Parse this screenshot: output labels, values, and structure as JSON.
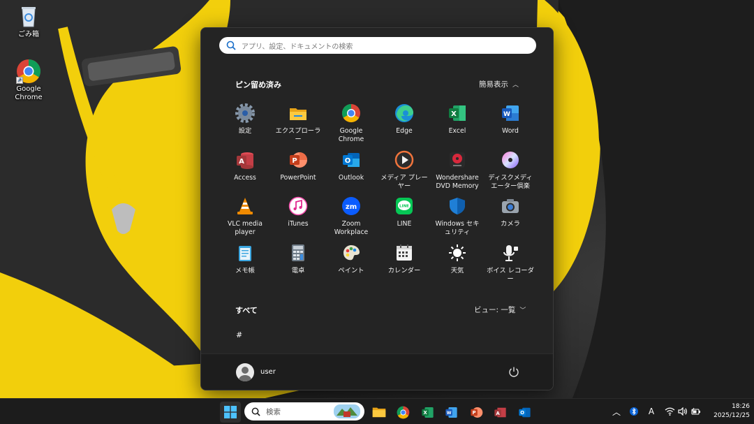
{
  "desktop": {
    "icons": [
      {
        "label": "ごみ箱",
        "icon": "recycle-bin-icon"
      },
      {
        "label": "Google Chrome",
        "icon": "chrome-icon"
      }
    ]
  },
  "start_menu": {
    "search_placeholder": "アプリ、設定、ドキュメントの検索",
    "pinned_title": "ピン留め済み",
    "pinned_toggle": "簡易表示",
    "pinned_apps": [
      {
        "label": "設定",
        "icon": "settings-gear-icon"
      },
      {
        "label": "エクスプローラー",
        "icon": "file-explorer-icon"
      },
      {
        "label": "Google Chrome",
        "icon": "chrome-icon"
      },
      {
        "label": "Edge",
        "icon": "edge-icon"
      },
      {
        "label": "Excel",
        "icon": "excel-icon"
      },
      {
        "label": "Word",
        "icon": "word-icon"
      },
      {
        "label": "Access",
        "icon": "access-icon"
      },
      {
        "label": "PowerPoint",
        "icon": "powerpoint-icon"
      },
      {
        "label": "Outlook",
        "icon": "outlook-icon"
      },
      {
        "label": "メディア プレーヤー",
        "icon": "media-player-icon"
      },
      {
        "label": "Wondershare DVD Memory",
        "icon": "dvd-memory-icon"
      },
      {
        "label": "ディスクメディエーター倶楽",
        "icon": "disc-icon"
      },
      {
        "label": "VLC media player",
        "icon": "vlc-cone-icon"
      },
      {
        "label": "iTunes",
        "icon": "itunes-icon"
      },
      {
        "label": "Zoom Workplace",
        "icon": "zoom-icon"
      },
      {
        "label": "LINE",
        "icon": "line-icon"
      },
      {
        "label": "Windows セキュリティ",
        "icon": "windows-security-shield-icon"
      },
      {
        "label": "カメラ",
        "icon": "camera-icon"
      },
      {
        "label": "メモ帳",
        "icon": "notepad-icon"
      },
      {
        "label": "電卓",
        "icon": "calculator-icon"
      },
      {
        "label": "ペイント",
        "icon": "paint-palette-icon"
      },
      {
        "label": "カレンダー",
        "icon": "calendar-icon"
      },
      {
        "label": "天気",
        "icon": "weather-sun-icon"
      },
      {
        "label": "ボイス レコーダー",
        "icon": "voice-recorder-icon"
      }
    ],
    "all_title": "すべて",
    "all_view": "ビュー: 一覧",
    "group_header": "#",
    "user_name": "user"
  },
  "taskbar": {
    "search_placeholder": "検索",
    "pinned": [
      "windows-start-icon",
      "file-explorer-icon",
      "chrome-icon",
      "excel-icon",
      "word-icon",
      "powerpoint-icon",
      "access-icon",
      "outlook-icon"
    ],
    "tray_ime": "A",
    "time": "18:26",
    "date": "2025/12/25"
  },
  "colors": {
    "start_bg": "#242424",
    "taskbar_bg": "#1c1c1c",
    "wallpaper_yellow": "#f5d20b"
  }
}
